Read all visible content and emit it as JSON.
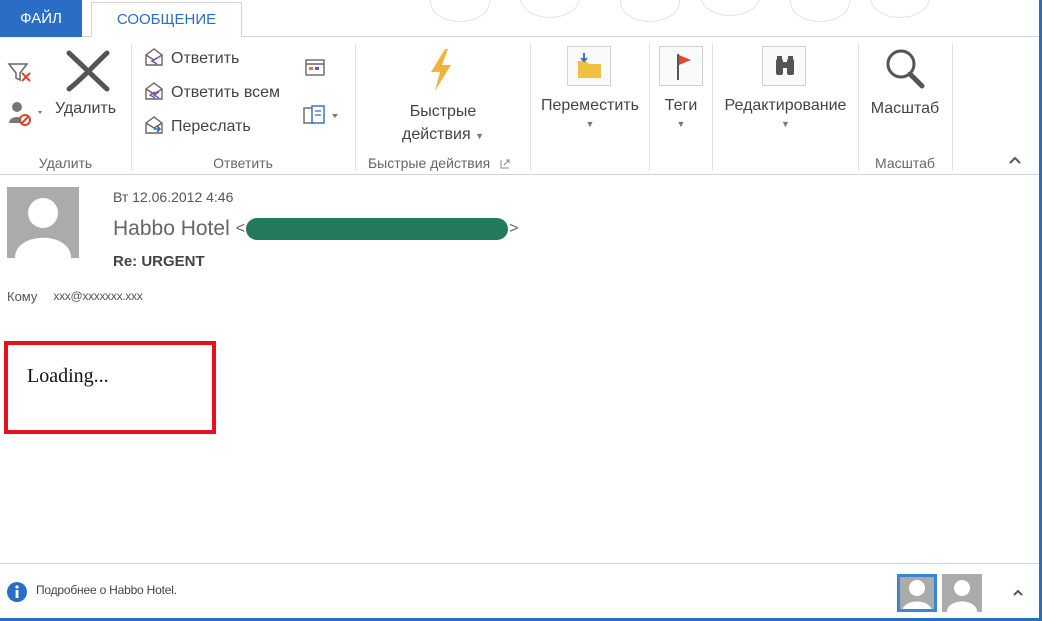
{
  "tabs": {
    "file": "ФАЙЛ",
    "message": "СООБЩЕНИЕ"
  },
  "ribbon": {
    "delete_group": {
      "label": "Удалить",
      "delete_button": "Удалить",
      "icons": [
        "ignore-icon",
        "junk-icon",
        "delete-x-icon"
      ]
    },
    "respond_group": {
      "label": "Ответить",
      "reply": "Ответить",
      "reply_all": "Ответить всем",
      "forward": "Переслать",
      "icons": [
        "reply-icon",
        "reply-all-icon",
        "forward-icon",
        "meeting-icon",
        "more-respond-icon"
      ]
    },
    "quick_steps_group": {
      "label": "Быстрые действия",
      "button_line1": "Быстрые",
      "button_line2": "действия",
      "icon": "lightning-icon"
    },
    "move": {
      "label": "Переместить",
      "icon": "move-folder-icon"
    },
    "tags": {
      "label": "Теги",
      "icon": "flag-icon"
    },
    "editing": {
      "label": "Редактирование",
      "icon": "binoculars-icon"
    },
    "zoom_group": {
      "label": "Масштаб",
      "button": "Масштаб",
      "icon": "magnifier-icon"
    }
  },
  "message": {
    "date": "Вт 12.06.2012 4:46",
    "sender_name": "Habbo Hotel",
    "sender_open": "<",
    "sender_close": ">",
    "subject": "Re: URGENT",
    "to_label": "Кому",
    "to_value": "xxx@xxxxxxx.xxx",
    "body_text": "Loading..."
  },
  "footer": {
    "info_text": "Подробнее о Habbo Hotel."
  },
  "colors": {
    "accent": "#2b6cc4",
    "highlight_box": "#e8101a",
    "redaction": "#237a5c",
    "flag": "#e04a2a",
    "lightning": "#f0b43c"
  }
}
